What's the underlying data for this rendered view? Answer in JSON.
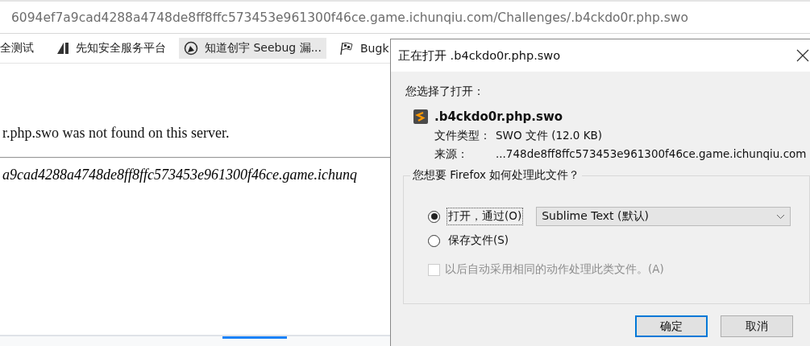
{
  "address_bar": {
    "url": "6094ef7a9cad4288a4748de8ff8ffc573453e961300f46ce.game.ichunqiu.com/Challenges/.b4ckdo0r.php.swo"
  },
  "bookmarks": [
    {
      "label": "全测试",
      "kind": "text",
      "hovered": false
    },
    {
      "label": "先知安全服务平台",
      "kind": "slash",
      "hovered": false
    },
    {
      "label": "知道创宇 Seebug 漏...",
      "kind": "seebug",
      "hovered": true
    },
    {
      "label": "Bugk",
      "kind": "flag",
      "hovered": false
    }
  ],
  "page": {
    "message": "r.php.swo was not found on this server.",
    "address": "a9cad4288a4748de8ff8ffc573453e961300f46ce.game.ichunq"
  },
  "dialog": {
    "title": "正在打开 .b4ckdo0r.php.swo",
    "prompt": "您选择了打开：",
    "file_name": ".b4ckdo0r.php.swo",
    "type_label": "文件类型：",
    "type_value": "SWO 文件 (12.0 KB)",
    "source_label": "来源：",
    "source_value": "...748de8ff8ffc573453e961300f46ce.game.ichunqiu.com",
    "group_title": "您想要 Firefox 如何处理此文件？",
    "options": [
      {
        "label": "打开，通过(O)",
        "selected": true,
        "focused": true
      },
      {
        "label": "保存文件(S)",
        "selected": false,
        "focused": false
      }
    ],
    "app": {
      "value": "Sublime Text (默认)"
    },
    "remember": {
      "label": "以后自动采用相同的动作处理此类文件。(A)",
      "checked": false,
      "disabled": true
    },
    "buttons": [
      {
        "label": "确定",
        "default": true
      },
      {
        "label": "取消",
        "default": false
      }
    ]
  }
}
